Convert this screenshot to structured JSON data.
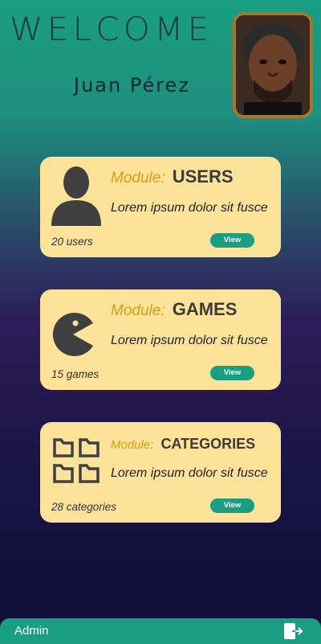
{
  "header": {
    "welcome": "WELCOME",
    "user_name": "Juan Pérez"
  },
  "modules": [
    {
      "label": "Module:",
      "name": "USERS",
      "description": "Lorem ipsum dolor sit fusce",
      "count": "20 users",
      "button": "View",
      "icon": "user-icon"
    },
    {
      "label": "Module:",
      "name": "GAMES",
      "description": "Lorem ipsum dolor sit fusce",
      "count": "15 games",
      "button": "View",
      "icon": "pacman-icon"
    },
    {
      "label": "Module:",
      "name": "CATEGORIES",
      "description": "Lorem ipsum dolor sit fusce",
      "count": "28 categories",
      "button": "View",
      "icon": "folders-icon"
    }
  ],
  "footer": {
    "role": "Admin",
    "logout_icon": "logout-icon"
  },
  "colors": {
    "accent": "#1a9e82",
    "card": "#fde39a",
    "module_label": "#d29f14"
  }
}
